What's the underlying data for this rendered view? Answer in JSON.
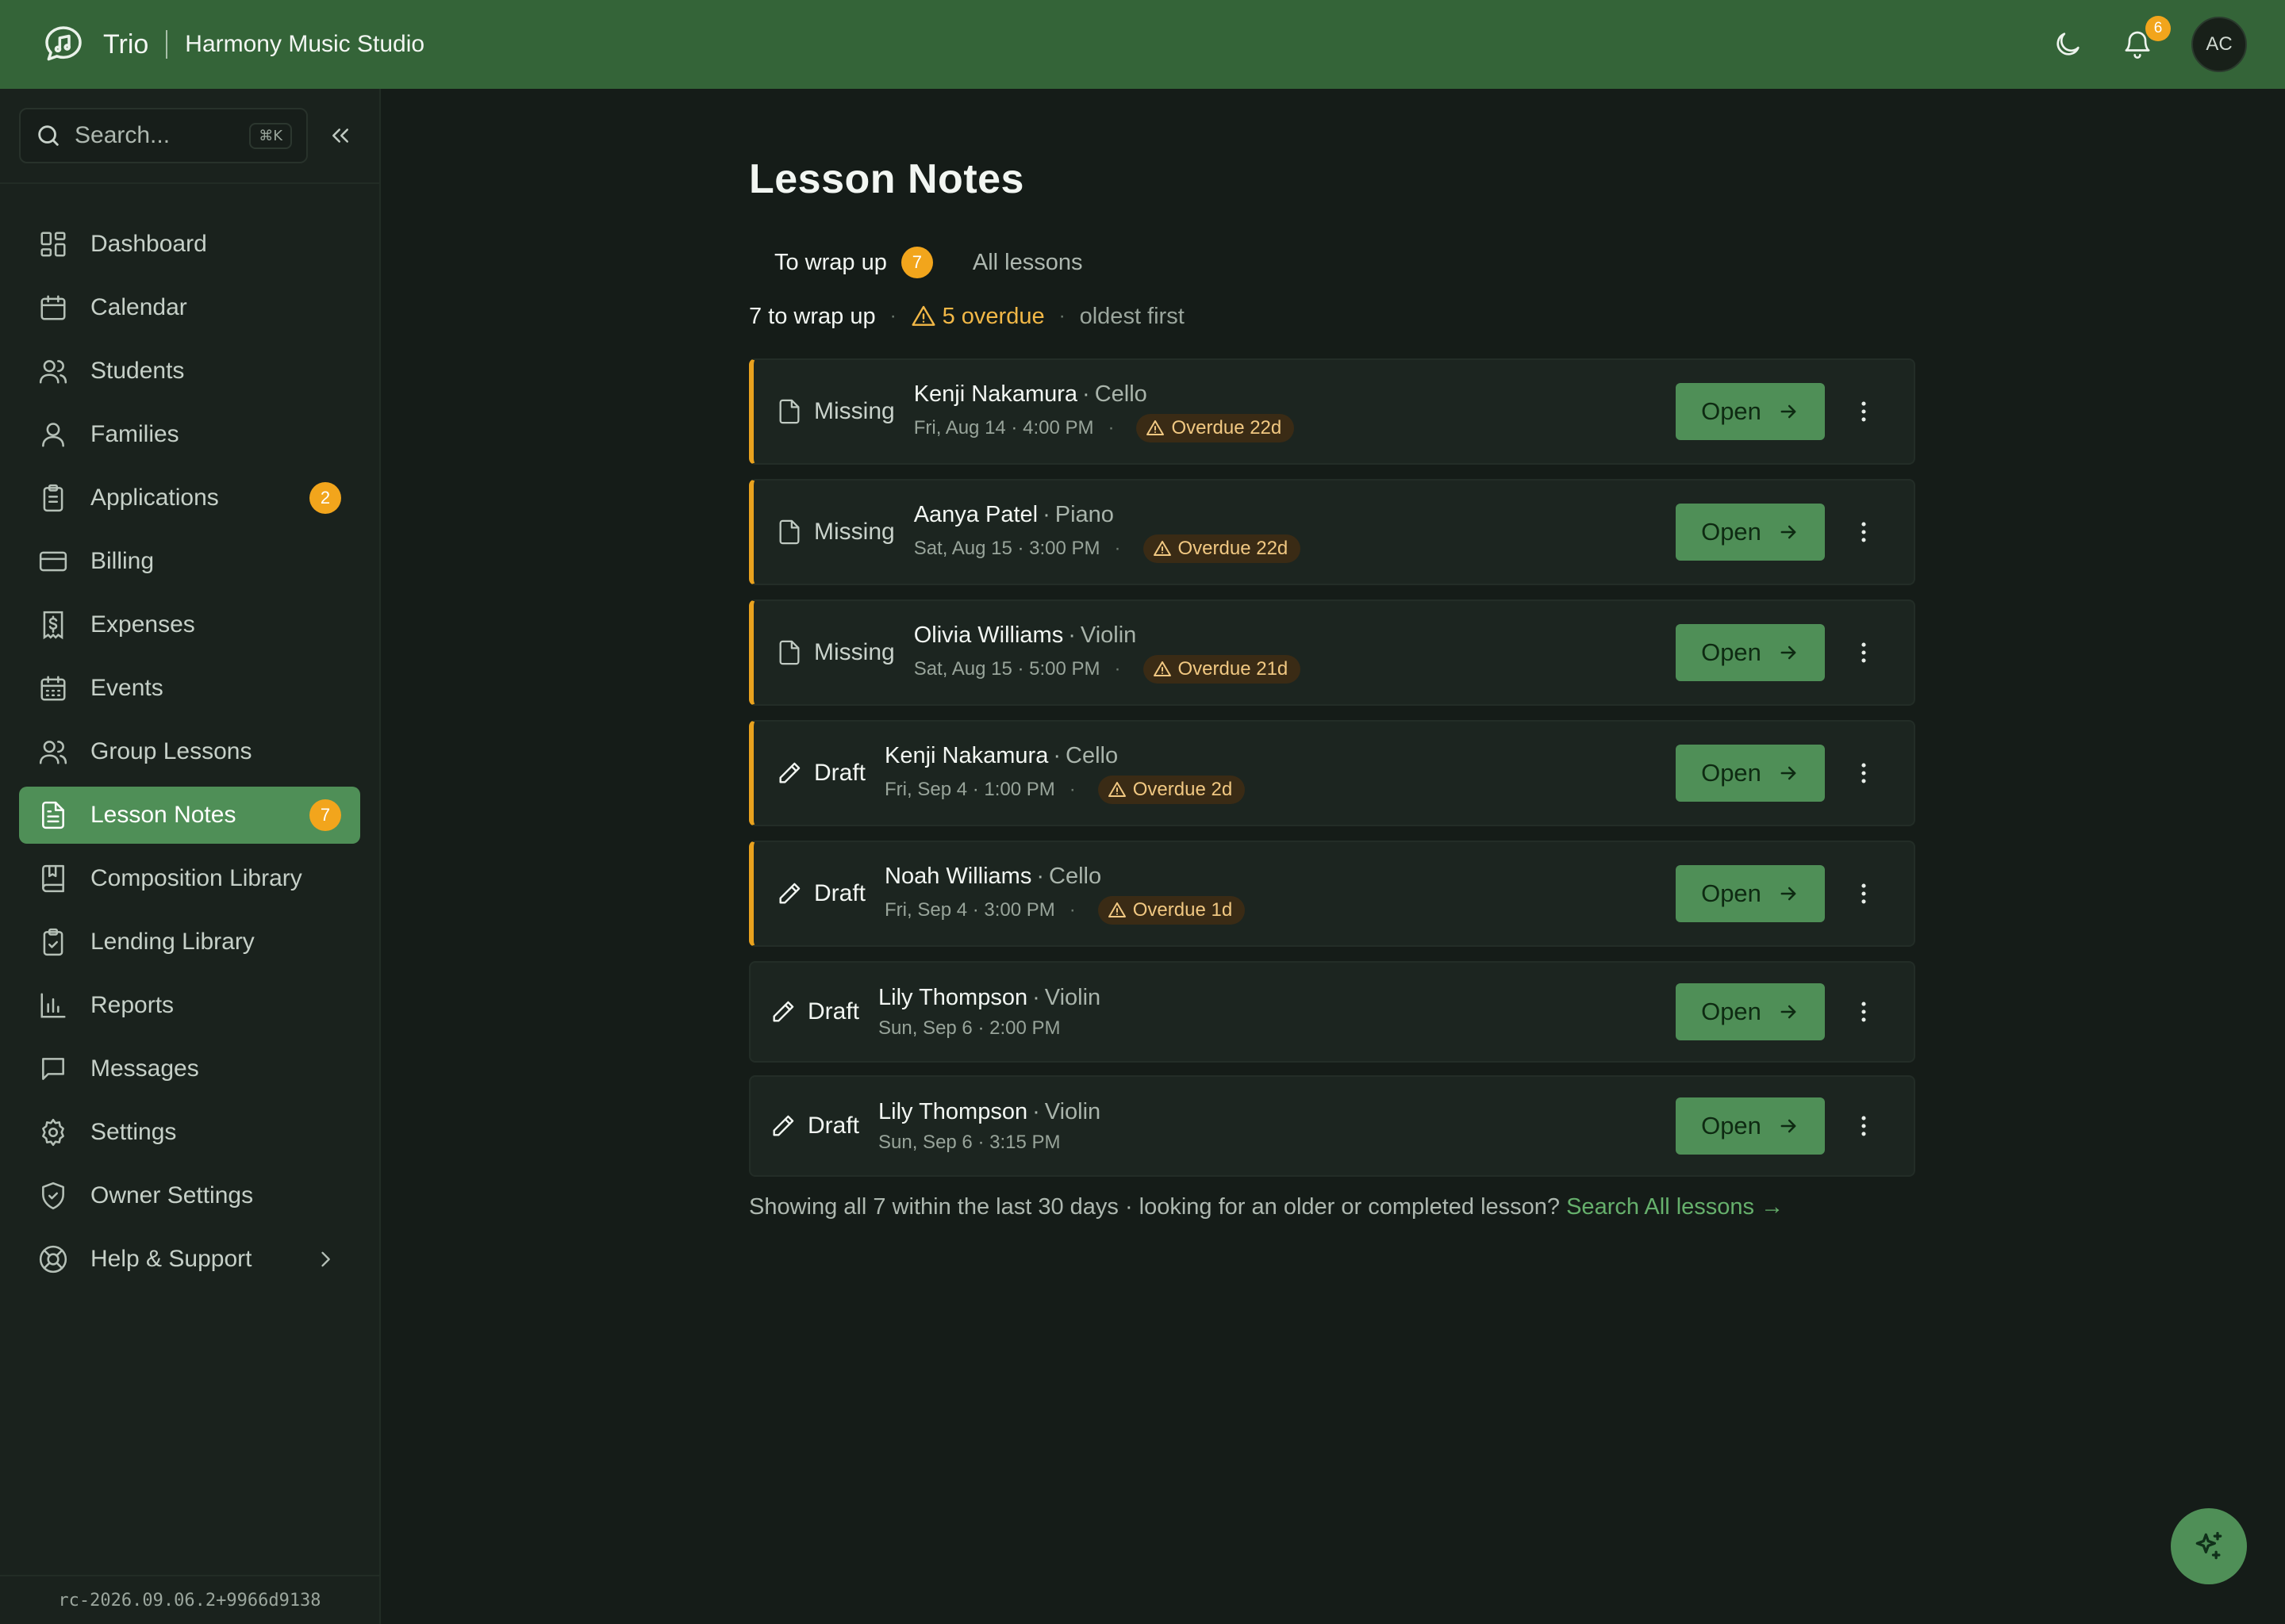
{
  "app": {
    "brand": "Trio",
    "studio": "Harmony Music Studio"
  },
  "topbar": {
    "notifications_count": "6",
    "avatar_initials": "AC"
  },
  "sidebar": {
    "search_placeholder": "Search...",
    "search_shortcut": "⌘K",
    "items": [
      {
        "label": "Dashboard",
        "icon": "dashboard-icon"
      },
      {
        "label": "Calendar",
        "icon": "calendar-icon"
      },
      {
        "label": "Students",
        "icon": "users-icon"
      },
      {
        "label": "Families",
        "icon": "user-icon"
      },
      {
        "label": "Applications",
        "icon": "clipboard-icon",
        "badge": "2"
      },
      {
        "label": "Billing",
        "icon": "credit-card-icon"
      },
      {
        "label": "Expenses",
        "icon": "receipt-icon"
      },
      {
        "label": "Events",
        "icon": "calendar-grid-icon"
      },
      {
        "label": "Group Lessons",
        "icon": "group-icon"
      },
      {
        "label": "Lesson Notes",
        "icon": "notes-icon",
        "badge": "7",
        "active": true
      },
      {
        "label": "Composition Library",
        "icon": "book-icon"
      },
      {
        "label": "Lending Library",
        "icon": "clipboard-check-icon"
      },
      {
        "label": "Reports",
        "icon": "bar-chart-icon"
      },
      {
        "label": "Messages",
        "icon": "message-icon"
      },
      {
        "label": "Settings",
        "icon": "gear-icon"
      },
      {
        "label": "Owner Settings",
        "icon": "shield-icon"
      },
      {
        "label": "Help & Support",
        "icon": "lifebuoy-icon"
      }
    ],
    "version": "rc-2026.09.06.2+9966d9138"
  },
  "main": {
    "title": "Lesson Notes",
    "tabs": [
      {
        "label": "To wrap up",
        "count": "7",
        "active": true
      },
      {
        "label": "All lessons"
      }
    ],
    "summary": {
      "count_text": "7 to wrap up",
      "overdue_text": "5 overdue",
      "sort_text": "oldest first"
    },
    "open_label": "Open",
    "lessons": [
      {
        "status": "Missing",
        "student": "Kenji Nakamura",
        "instrument": "Cello",
        "when": "Fri, Aug 14 · 4:00 PM",
        "overdue": "Overdue 22d"
      },
      {
        "status": "Missing",
        "student": "Aanya Patel",
        "instrument": "Piano",
        "when": "Sat, Aug 15 · 3:00 PM",
        "overdue": "Overdue 22d"
      },
      {
        "status": "Missing",
        "student": "Olivia Williams",
        "instrument": "Violin",
        "when": "Sat, Aug 15 · 5:00 PM",
        "overdue": "Overdue 21d"
      },
      {
        "status": "Draft",
        "student": "Kenji Nakamura",
        "instrument": "Cello",
        "when": "Fri, Sep 4 · 1:00 PM",
        "overdue": "Overdue 2d"
      },
      {
        "status": "Draft",
        "student": "Noah Williams",
        "instrument": "Cello",
        "when": "Fri, Sep 4 · 3:00 PM",
        "overdue": "Overdue 1d"
      },
      {
        "status": "Draft",
        "student": "Lily Thompson",
        "instrument": "Violin",
        "when": "Sun, Sep 6 · 2:00 PM"
      },
      {
        "status": "Draft",
        "student": "Lily Thompson",
        "instrument": "Violin",
        "when": "Sun, Sep 6 · 3:15 PM"
      }
    ],
    "footer": {
      "text": "Showing all 7 within the last 30 days · looking for an older or completed lesson?",
      "link": "Search All lessons →"
    }
  },
  "colors": {
    "topbar": "#346438",
    "accent": "#4f8f57",
    "badge": "#f2a51c",
    "overdue": "#f2b847",
    "background": "#151c18"
  }
}
